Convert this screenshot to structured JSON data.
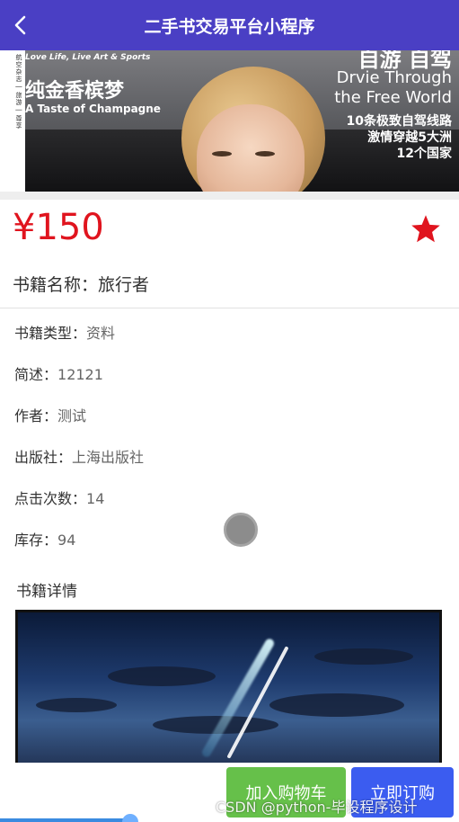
{
  "navbar": {
    "title": "二手书交易平台小程序",
    "back_icon": "back-arrow-icon"
  },
  "banner": {
    "tagline": "Love Life, Live Art & Sports",
    "cn_title": "纯金香槟梦",
    "en_title": "A Taste of Champagne",
    "top_right": "自游 自驾",
    "right_line_1": "Drvie Through",
    "right_line_2": "the Free World",
    "right_line_3": "10条极致自驾线路",
    "right_line_4": "激情穿越5大洲",
    "right_line_5": "12个国家",
    "spine_text": "航空杂志 | 旅游 | 尊享"
  },
  "price": "¥150",
  "favorite_icon": "star-icon",
  "favorite_color": "#e0141e",
  "book_name": {
    "label": "书籍名称：",
    "value": "旅行者"
  },
  "info": [
    {
      "label": "书籍类型：",
      "value": "资料"
    },
    {
      "label": "简述：",
      "value": "12121"
    },
    {
      "label": "作者：",
      "value": "测试"
    },
    {
      "label": "出版社：",
      "value": "上海出版社"
    },
    {
      "label": "点击次数：",
      "value": "14"
    },
    {
      "label": "库存：",
      "value": "94"
    }
  ],
  "detail_title": "书籍详情",
  "actions": {
    "add_to_cart": "加入购物车",
    "buy_now": "立即订购"
  },
  "watermark": "CSDN @python-毕设程序设计",
  "colors": {
    "navbar": "#4a3fc4",
    "price": "#e0141e",
    "cart_button": "#66c04a",
    "buy_button": "#3b5cf0"
  }
}
